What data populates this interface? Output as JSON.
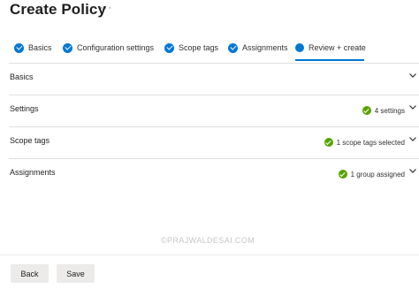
{
  "header": {
    "title": "Create Policy",
    "more_label": "···"
  },
  "tabs": [
    {
      "label": "Basics",
      "state": "complete"
    },
    {
      "label": "Configuration settings",
      "state": "complete"
    },
    {
      "label": "Scope tags",
      "state": "complete"
    },
    {
      "label": "Assignments",
      "state": "complete"
    },
    {
      "label": "Review + create",
      "state": "current"
    }
  ],
  "sections": [
    {
      "name": "Basics",
      "status": ""
    },
    {
      "name": "Settings",
      "status": "4 settings"
    },
    {
      "name": "Scope tags",
      "status": "1 scope tags selected"
    },
    {
      "name": "Assignments",
      "status": "1 group assigned"
    }
  ],
  "footer": {
    "back_label": "Back",
    "save_label": "Save"
  },
  "watermark": "©PRAJWALDESAI.COM",
  "colors": {
    "accent": "#0078d4",
    "success": "#57a300",
    "button_bg": "#edebe9"
  }
}
